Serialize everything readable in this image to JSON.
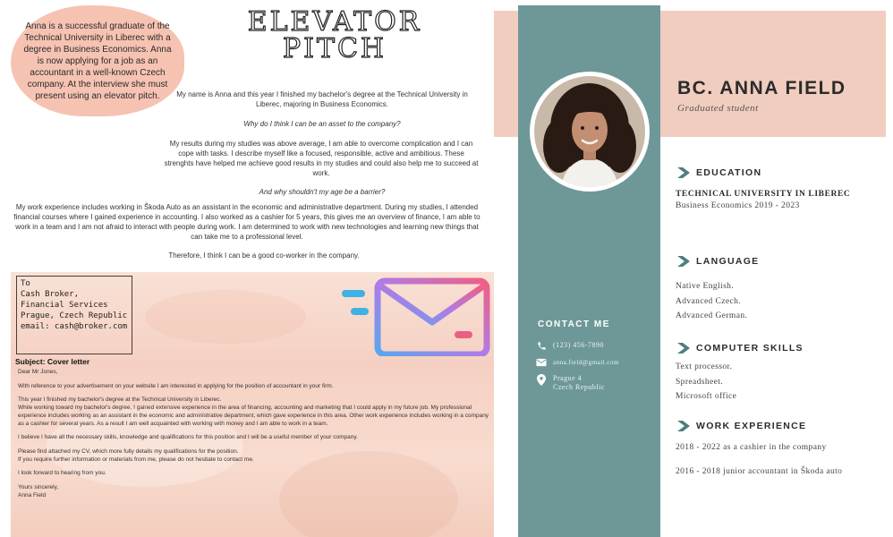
{
  "pitch": {
    "intro": "Anna is a successful graduate of the Technical University in Liberec with a degree in Business Economics. Anna is now applying for a job as an accountant in a well-known Czech company. At the interview she must present using an elevator pitch.",
    "title_line1": "ELEVATOR",
    "title_line2": "PITCH",
    "p1": "My name is Anna and this year I finished my bachelor's degree at the Technical University in Liberec, majoring in Business Economics.",
    "q1": "Why do I think I can be an asset to the company?",
    "p2": "My results during my studies was above average, I am able to overcome complication and I can cope with tasks. I describe myself like a focused, responsible, active and ambitious. These strenghts have helped me achieve good results in my studies and could also help me to succeed at work.",
    "q2": "And why shouldn't my age be a barrier?",
    "p3": "My work experience includes working in Škoda Auto as an assistant in the economic and administrative department. During my studies, I attended financial courses where I gained experience in accounting. I also worked as a cashier for 5 years, this gives me an overview of finance, I am able to work in a team and I am not afraid to interact with people during work. I am determined to work with new technologies and learning new things that can take me to a professional level.",
    "p4": "Therefore, I think I can be a good co-worker in the company."
  },
  "letter": {
    "to": "To",
    "recipient": "Cash Broker,",
    "department": "Financial Services",
    "city": "Prague, Czech Republic",
    "email": "email: cash@broker.com",
    "subject": "Subject: Cover letter",
    "greeting": "Dear Mr Jones,",
    "p1": "With reference to your advertisement on your website I am interested in applying for the position of accountant in your firm.",
    "p2a": "This year I finished my bachelor's degree at the Technical University in Liberec.",
    "p2b": "While working toward my bachelor's degree, I gained extensive experience in the area of financing, accounting and marketing that I could apply in my future job. My professional experience includes working as an assistant in the economic and administrative department, which gave experience in this area. Other work experience includes working in a company as a cashier for several years. As a result I am well acquainted with working with money and I am able to work in a team.",
    "p3": "I believe I have all the necessary skills, knowledge and qualifications for this position and I will be a useful member of your company.",
    "p4a": "Please find attached my CV, which more fully details my qualifications for the position.",
    "p4b": "If you require further information or materials from me, please do not hesitate to contact me.",
    "p5": "I look forward to hearing from you.",
    "closing": "Yours sincerely,",
    "signature": "Anna Field"
  },
  "cv": {
    "name": "BC. ANNA FIELD",
    "subtitle": "Graduated student",
    "contact_heading": "CONTACT ME",
    "phone": "(123) 456-7890",
    "email": "anna.field@gmail.com",
    "address1": "Prague 4",
    "address2": "Czech Republic",
    "education_heading": "EDUCATION",
    "school": "TECHNICAL UNIVERSITY IN LIBEREC",
    "program": "Business Economics 2019 - 2023",
    "language_heading": "LANGUAGE",
    "languages": [
      "Native English.",
      "Advanced Czech.",
      "Advanced German."
    ],
    "skills_heading": "COMPUTER SKILLS",
    "skills": [
      "Text processor.",
      "Spreadsheet.",
      "Microsoft office"
    ],
    "work_heading": "WORK EXPERIENCE",
    "work": [
      "2018 - 2022 as a cashier in the company",
      "2016 - 2018 junior accountant in Škoda auto"
    ]
  },
  "colors": {
    "peach": "#f6c3b2",
    "teal": "#6e9898",
    "band": "#f1cdbf",
    "arrow": "#4e7d7d"
  },
  "icons": {
    "envelope": "envelope-icon",
    "phone": "phone-icon",
    "mail": "mail-icon",
    "location": "location-pin-icon",
    "section": "chevron-right-icon"
  }
}
